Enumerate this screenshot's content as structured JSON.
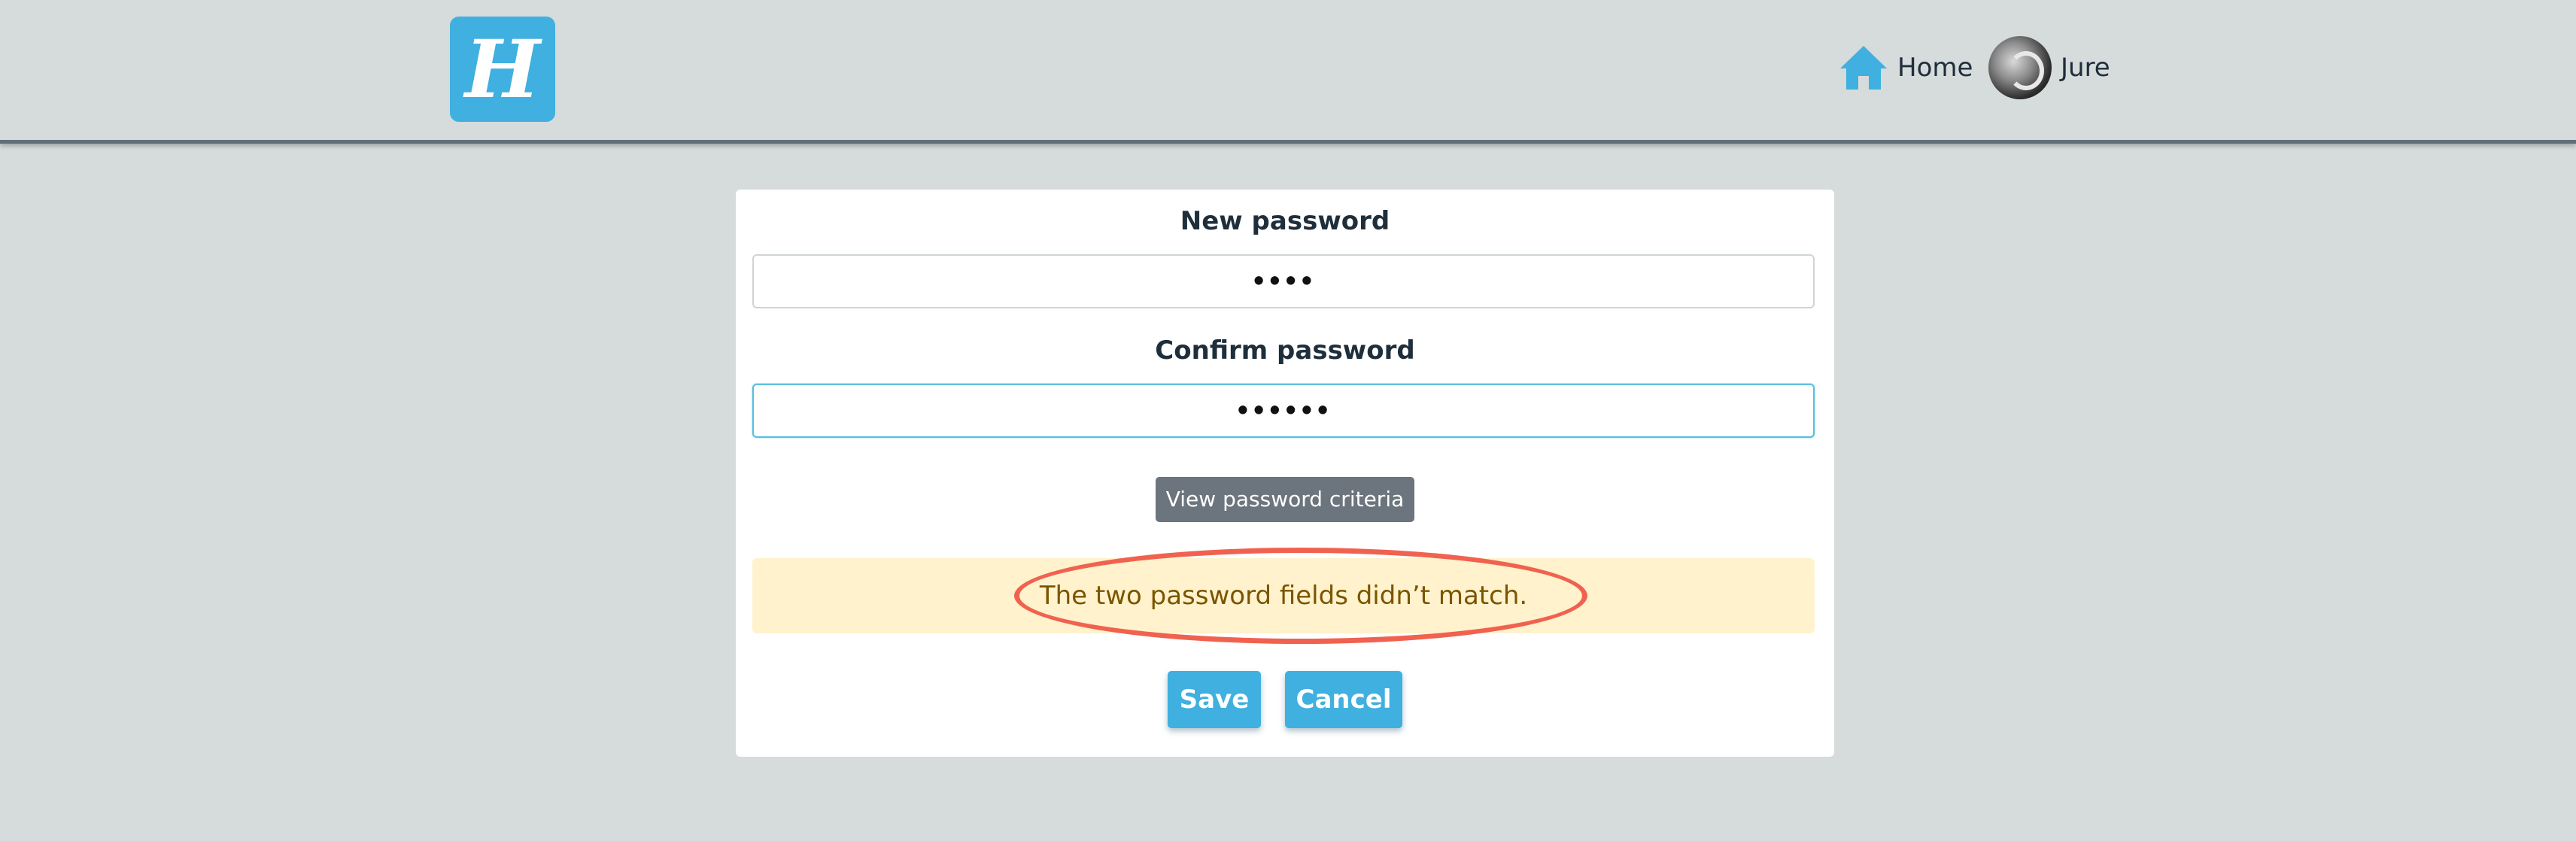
{
  "header": {
    "logo_letter": "H",
    "nav": {
      "home_label": "Home",
      "user_label": "Jure"
    }
  },
  "form": {
    "new_password": {
      "label": "New password",
      "masked_value": "••••"
    },
    "confirm_password": {
      "label": "Confirm password",
      "masked_value": "••••••"
    },
    "criteria_button_label": "View password criteria",
    "alert_message": "The two password fields didn’t match.",
    "save_label": "Save",
    "cancel_label": "Cancel"
  },
  "colors": {
    "accent": "#3fb0e0",
    "alert_background": "#fff2cd",
    "alert_text": "#7a5500",
    "highlight_ring": "#f0624f",
    "secondary_button": "#6c757d"
  },
  "icons": {
    "home": "home-icon",
    "avatar": "avatar"
  }
}
